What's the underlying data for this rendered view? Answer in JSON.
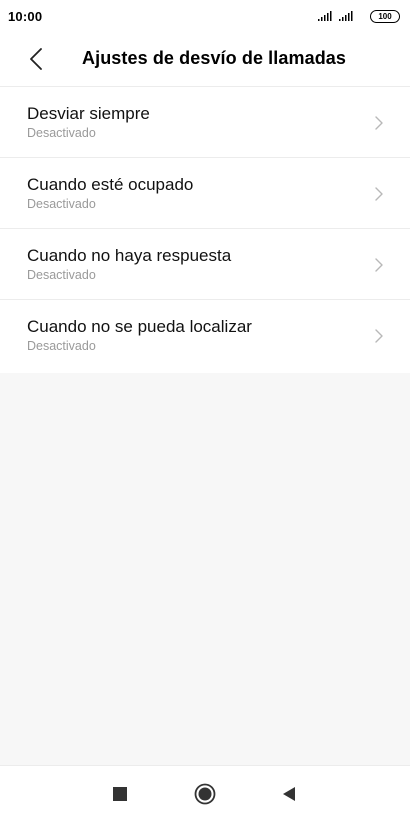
{
  "status_bar": {
    "time": "10:00",
    "battery": "100",
    "icons": [
      "signal-icon",
      "signal-icon",
      "battery-icon"
    ]
  },
  "header": {
    "title": "Ajustes de desvío de llamadas",
    "back_icon": "back-chevron-icon"
  },
  "items": [
    {
      "label": "Desviar siempre",
      "value": "Desactivado"
    },
    {
      "label": "Cuando esté ocupado",
      "value": "Desactivado"
    },
    {
      "label": "Cuando no haya respuesta",
      "value": "Desactivado"
    },
    {
      "label": "Cuando no se pueda localizar",
      "value": "Desactivado"
    }
  ],
  "nav_bar": {
    "icons": [
      "recents-square-icon",
      "home-circle-icon",
      "back-triangle-icon"
    ]
  },
  "colors": {
    "background": "#f7f7f7",
    "surface": "#ffffff",
    "divider": "#ececec",
    "secondary_text": "#9a9a9a",
    "chevron": "#b8b8b8"
  }
}
